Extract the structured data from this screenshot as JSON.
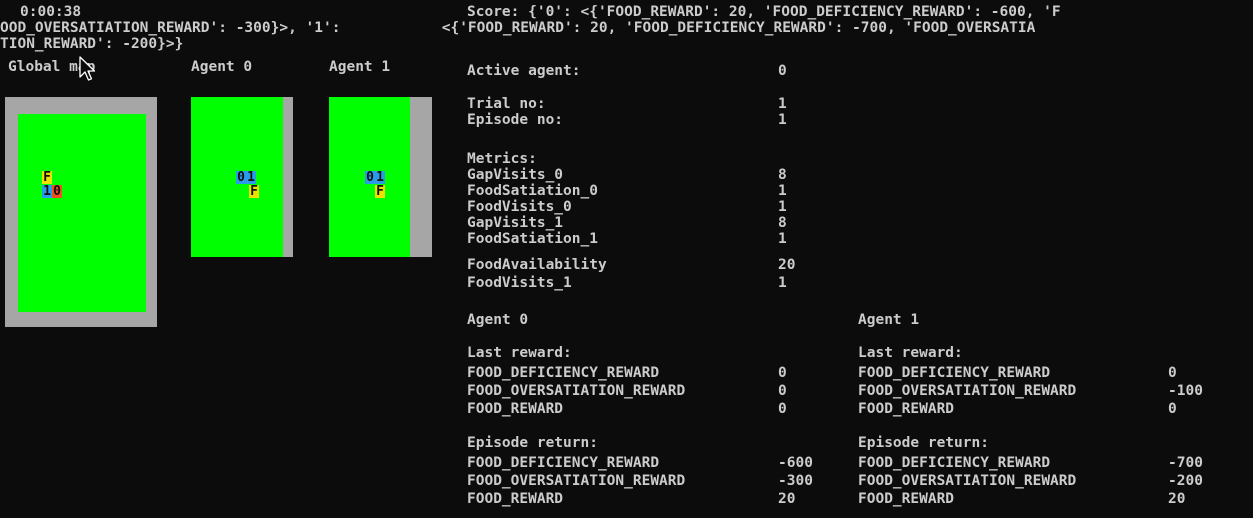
{
  "header": {
    "timer": "0:00:38",
    "score_line1": "Score: {'0': <{'FOOD_REWARD': 20, 'FOOD_DEFICIENCY_REWARD': -600, 'F",
    "wrap_line2_left": "OOD_OVERSATIATION_REWARD': -300}>, '1':",
    "wrap_line2_right": " <{'FOOD_REWARD': 20, 'FOOD_DEFICIENCY_REWARD': -700, 'FOOD_OVERSATIA",
    "wrap_line3": "TION_REWARD': -200}>}"
  },
  "maps": {
    "global_label": "Global map",
    "agent0_label": "Agent 0",
    "agent1_label": "Agent 1",
    "global": {
      "food": "F",
      "agent_a": "1",
      "agent_b": "0"
    },
    "agent0": {
      "agent_a": "0",
      "agent_b": "1",
      "food": "F"
    },
    "agent1": {
      "agent_a": "0",
      "agent_b": "1",
      "food": "F"
    }
  },
  "status": {
    "active_agent_label": "Active agent:",
    "active_agent_value": "0",
    "trial_label": "Trial no:",
    "trial_value": "1",
    "episode_label": "Episode no:",
    "episode_value": "1",
    "metrics_label": "Metrics:",
    "metrics": [
      {
        "name": "GapVisits_0",
        "value": "8"
      },
      {
        "name": "FoodSatiation_0",
        "value": "1"
      },
      {
        "name": "FoodVisits_0",
        "value": "1"
      },
      {
        "name": "GapVisits_1",
        "value": "8"
      },
      {
        "name": "FoodSatiation_1",
        "value": "1"
      },
      {
        "name": "FoodAvailability",
        "value": "20"
      },
      {
        "name": "FoodVisits_1",
        "value": "1"
      }
    ]
  },
  "agents": [
    {
      "title": "Agent 0",
      "last_reward_label": "Last reward:",
      "last_reward": [
        {
          "name": "FOOD_DEFICIENCY_REWARD",
          "value": "0"
        },
        {
          "name": "FOOD_OVERSATIATION_REWARD",
          "value": "0"
        },
        {
          "name": "FOOD_REWARD",
          "value": "0"
        }
      ],
      "episode_return_label": "Episode return:",
      "episode_return": [
        {
          "name": "FOOD_DEFICIENCY_REWARD",
          "value": "-600"
        },
        {
          "name": "FOOD_OVERSATIATION_REWARD",
          "value": "-300"
        },
        {
          "name": "FOOD_REWARD",
          "value": "20"
        }
      ]
    },
    {
      "title": "Agent 1",
      "last_reward_label": "Last reward:",
      "last_reward": [
        {
          "name": "FOOD_DEFICIENCY_REWARD",
          "value": "0"
        },
        {
          "name": "FOOD_OVERSATIATION_REWARD",
          "value": "-100"
        },
        {
          "name": "FOOD_REWARD",
          "value": "0"
        }
      ],
      "episode_return_label": "Episode return:",
      "episode_return": [
        {
          "name": "FOOD_DEFICIENCY_REWARD",
          "value": "-700"
        },
        {
          "name": "FOOD_OVERSATIATION_REWARD",
          "value": "-200"
        },
        {
          "name": "FOOD_REWARD",
          "value": "20"
        }
      ]
    }
  ],
  "colors": {
    "background": "#0c0c0c",
    "text": "#cccccc",
    "wall": "#a6a6a6",
    "grass": "#00ff00",
    "food": "#f0e000",
    "agent": "#2a9be8",
    "agent_highlight": "#f05020"
  },
  "icons": {
    "cursor": "mouse-pointer-icon"
  }
}
